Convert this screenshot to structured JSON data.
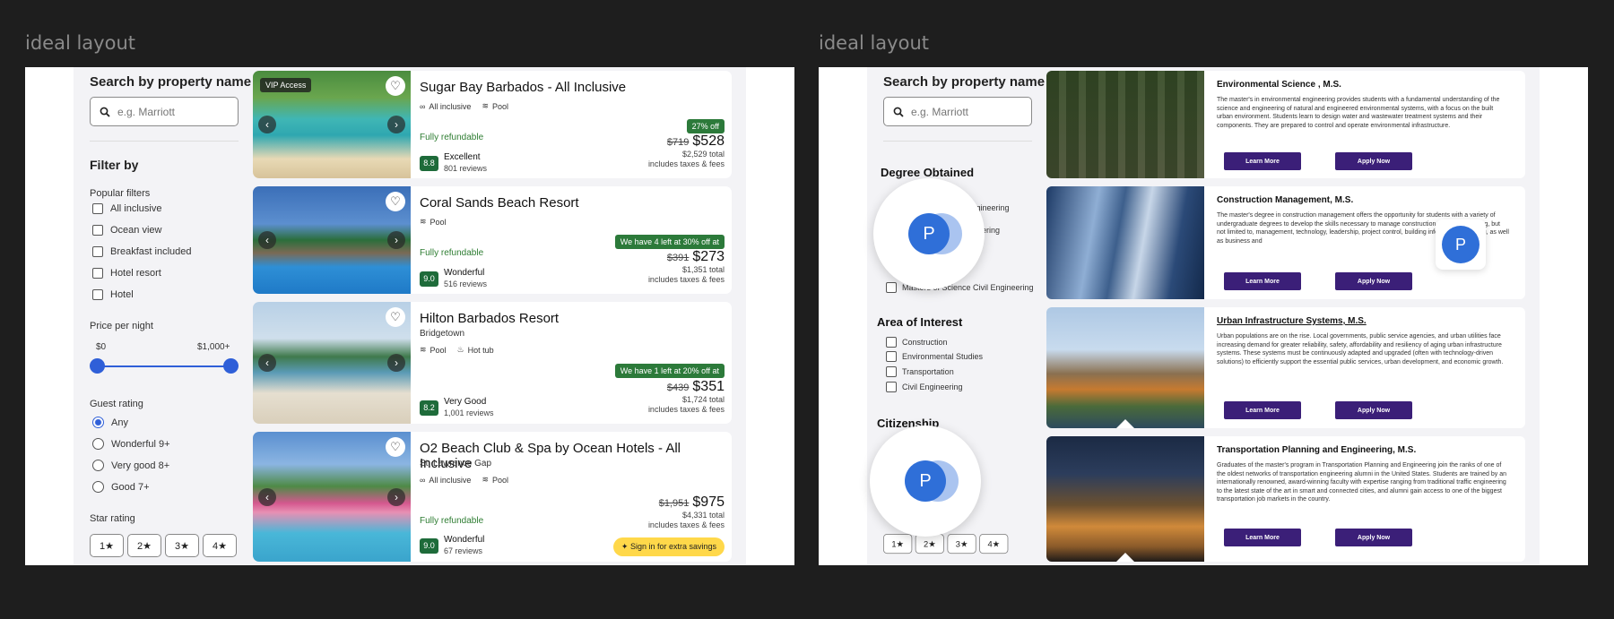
{
  "left": {
    "label": "ideal layout",
    "search": {
      "title": "Search by property name",
      "placeholder": "e.g. Marriott"
    },
    "filter_title": "Filter by",
    "popular": {
      "title": "Popular filters",
      "items": [
        "All inclusive",
        "Ocean view",
        "Breakfast included",
        "Hotel resort",
        "Hotel"
      ]
    },
    "price": {
      "title": "Price per night",
      "min": "$0",
      "max": "$1,000+"
    },
    "guest": {
      "title": "Guest rating",
      "items": [
        "Any",
        "Wonderful 9+",
        "Very good 8+",
        "Good 7+"
      ]
    },
    "star": {
      "title": "Star rating",
      "items": [
        "1★",
        "2★",
        "3★",
        "4★"
      ]
    },
    "cards": [
      {
        "title": "Sugar Bay Barbados - All Inclusive",
        "badge": "VIP Access",
        "subtitle": "",
        "amenities": [
          "All inclusive",
          "Pool"
        ],
        "refund": "Fully refundable",
        "deal": "27% off",
        "old": "$719",
        "price": "$528",
        "total": "$2,529 total",
        "taxes": "includes taxes & fees",
        "score": "8.8",
        "rating": "Excellent",
        "reviews": "801 reviews"
      },
      {
        "title": "Coral Sands Beach Resort",
        "subtitle": "",
        "amenities": [
          "Pool"
        ],
        "refund": "Fully refundable",
        "deal": "We have 4 left at 30% off at",
        "old": "$391",
        "price": "$273",
        "total": "$1,351 total",
        "taxes": "includes taxes & fees",
        "score": "9.0",
        "rating": "Wonderful",
        "reviews": "516 reviews"
      },
      {
        "title": "Hilton Barbados Resort",
        "subtitle": "Bridgetown",
        "amenities": [
          "Pool",
          "Hot tub"
        ],
        "refund": "",
        "deal": "We have 1 left at 20% off at",
        "old": "$439",
        "price": "$351",
        "total": "$1,724 total",
        "taxes": "includes taxes & fees",
        "score": "8.2",
        "rating": "Very Good",
        "reviews": "1,001 reviews"
      },
      {
        "title": "O2 Beach Club & Spa by Ocean Hotels - All Inclusive",
        "subtitle": "St. Lawrence Gap",
        "amenities": [
          "All inclusive",
          "Pool"
        ],
        "refund": "Fully refundable",
        "deal": "",
        "old": "$1,951",
        "price": "$975",
        "total": "$4,331 total",
        "taxes": "includes taxes & fees",
        "score": "9.0",
        "rating": "Wonderful",
        "reviews": "67 reviews",
        "signin": "Sign in for extra savings"
      }
    ]
  },
  "right": {
    "label": "ideal layout",
    "search": {
      "title": "Search by property name",
      "placeholder": "e.g. Marriott"
    },
    "degree": {
      "title": "Degree Obtained",
      "items": [
        "il Engineering",
        "ineering",
        "Masters of Science Civil Engineering"
      ]
    },
    "interest": {
      "title": "Area of Interest",
      "items": [
        "Construction",
        "Environmental Studies",
        "Transportation",
        "Civil Engineering"
      ]
    },
    "citizenship": {
      "title": "Citizenship"
    },
    "avatar_letter": "P",
    "stars": [
      "1★",
      "2★",
      "3★",
      "4★"
    ],
    "programs": [
      {
        "title": "Environmental Science , M.S.",
        "desc": "The master's in environmental engineering provides students with a fundamental understanding of the science and engineering of natural and engineered environmental systems, with a focus on the built urban environment. Students learn to design water and wastewater treatment systems and their components. They are prepared to control and operate environmental infrastructure."
      },
      {
        "title": "Construction Management, M.S.",
        "desc": "The master's degree in construction management offers the opportunity for students with a variety of undergraduate degrees to develop the skills necessary to manage construction projects, including, but not limited to, management, technology, leadership, project control, building information modeling, as well as business and"
      },
      {
        "title": "Urban Infrastructure Systems, M.S.",
        "desc": "Urban populations are on the rise. Local governments, public service agencies, and urban utilities face increasing demand for greater reliability, safety, affordability and resiliency of aging urban infrastructure systems. These systems must be continuously adapted and upgraded (often with technology-driven solutions) to efficiently support the essential public services, urban development, and economic growth."
      },
      {
        "title": "Transportation Planning and Engineering, M.S.",
        "desc": "Graduates of the master's program in Transportation Planning and Engineering join the ranks of one of the oldest networks of transportation engineering alumni in the United States. Students are trained by an internationally renowned, award-winning faculty with expertise ranging from traditional traffic engineering to the latest state of the art in smart and connected cities, and alumni gain access to one of the biggest transportation job markets in the country."
      }
    ],
    "learn": "Learn More",
    "apply": "Apply Now"
  }
}
